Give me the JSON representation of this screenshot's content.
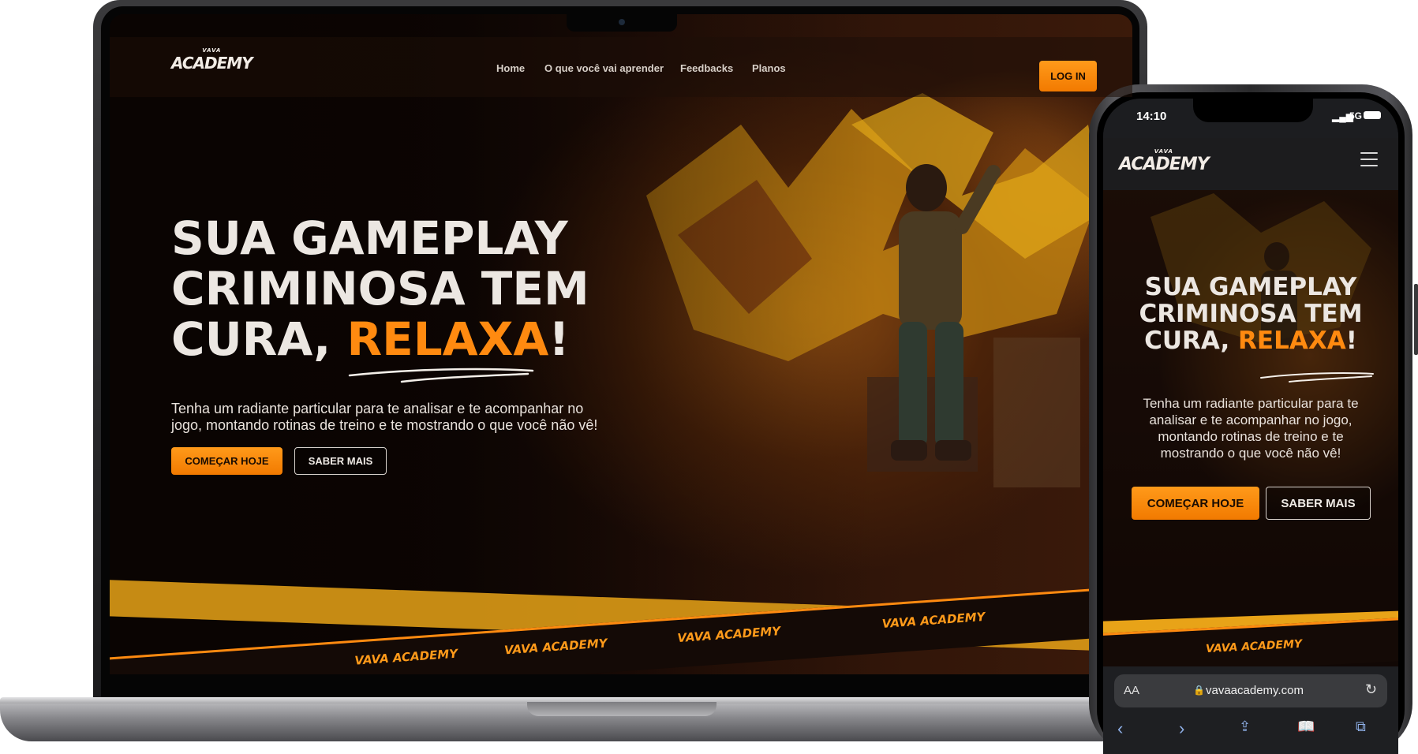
{
  "brand": {
    "logo_top": "VAVA",
    "logo_main": "ACADEMY",
    "accent_color": "#ff8a10"
  },
  "desktop": {
    "nav": {
      "items": [
        {
          "label": "Home"
        },
        {
          "label": "O que você vai aprender"
        },
        {
          "label": "Feedbacks"
        },
        {
          "label": "Planos"
        }
      ],
      "login_label": "LOG IN"
    },
    "hero": {
      "title_line1": "SUA GAMEPLAY",
      "title_line2": "CRIMINOSA TEM",
      "title_line3_prefix": "CURA, ",
      "title_accent": "RELAXA",
      "title_suffix": "!",
      "subtitle_line1": "Tenha um radiante particular para te analisar e te acompanhar no",
      "subtitle_line2": "jogo, montando rotinas de treino e te mostrando o que você não vê!",
      "cta_primary": "COMEÇAR HOJE",
      "cta_secondary": "SABER MAIS"
    },
    "tape_text": "VAVA ACADEMY"
  },
  "mobile": {
    "status": {
      "time": "14:10",
      "network": "5G"
    },
    "hero": {
      "title_line1": "SUA GAMEPLAY",
      "title_line2": "CRIMINOSA TEM",
      "title_line3_prefix": "CURA, ",
      "title_accent": "RELAXA",
      "title_suffix": "!",
      "subtitle_line1": "Tenha um radiante particular para te",
      "subtitle_line2": "analisar e te acompanhar no jogo,",
      "subtitle_line3": "montando rotinas de treino e te",
      "subtitle_line4": "mostrando o que você não vê!",
      "cta_primary": "COMEÇAR HOJE",
      "cta_secondary": "SABER MAIS"
    },
    "tape_text": "VAVA ACADEMY",
    "safari": {
      "text_size_label": "AA",
      "url": "vavaacademy.com",
      "lock_icon": "lock-icon",
      "reload_icon": "reload-icon",
      "toolbar_icons": [
        "back-icon",
        "forward-icon",
        "share-icon",
        "bookmarks-icon",
        "tabs-icon"
      ]
    }
  }
}
